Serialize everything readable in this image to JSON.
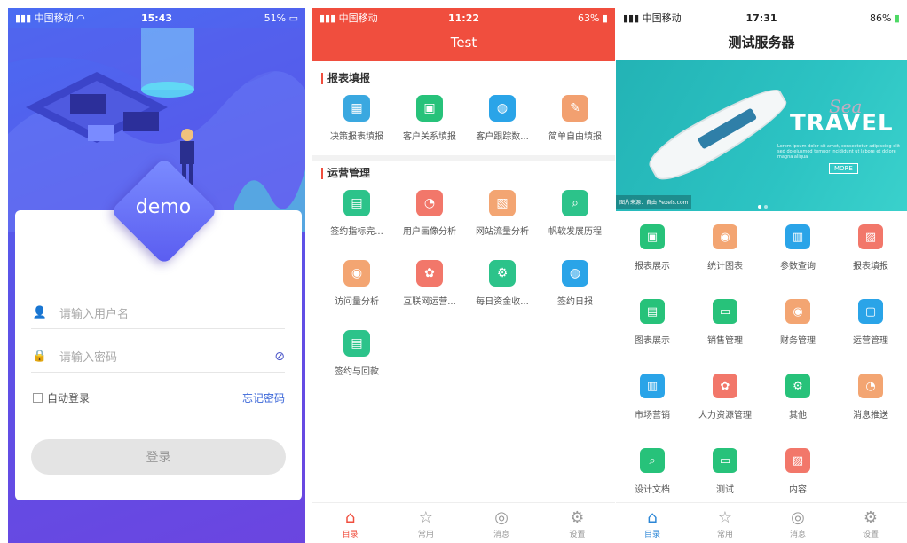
{
  "screen1": {
    "status": {
      "carrier": "中国移动",
      "time": "15:43",
      "battery": "51%"
    },
    "logo_text": "demo",
    "username_placeholder": "请输入用户名",
    "password_placeholder": "请输入密码",
    "remember_label": "自动登录",
    "forgot_label": "忘记密码",
    "login_label": "登录",
    "icons": {
      "user": "user-icon",
      "lock": "lock-icon",
      "eye": "eye-off-icon"
    }
  },
  "screen2": {
    "status": {
      "carrier": "中国移动",
      "time": "11:22",
      "battery": "63%"
    },
    "title": "Test",
    "accent": "#f04e3e",
    "section1": {
      "title": "报表填报",
      "items": [
        {
          "label": "决策报表填报",
          "color": "#3aa8e0",
          "icon": "▦"
        },
        {
          "label": "客户关系填报",
          "color": "#27c27a",
          "icon": "▣"
        },
        {
          "label": "客户跟踪数...",
          "color": "#2aa4e8",
          "icon": "◍"
        },
        {
          "label": "简单自由填报",
          "color": "#f2a070",
          "icon": "✎"
        }
      ]
    },
    "section2": {
      "title": "运营管理",
      "items": [
        {
          "label": "签约指标完...",
          "color": "#2cc38a",
          "icon": "▤"
        },
        {
          "label": "用户画像分析",
          "color": "#f2776a",
          "icon": "◔"
        },
        {
          "label": "网站流量分析",
          "color": "#f3a572",
          "icon": "▧"
        },
        {
          "label": "帆软发展历程",
          "color": "#2cc38a",
          "icon": "⌕"
        },
        {
          "label": "访问量分析",
          "color": "#f3a572",
          "icon": "◉"
        },
        {
          "label": "互联网运营...",
          "color": "#f2776a",
          "icon": "✿"
        },
        {
          "label": "每日资金收...",
          "color": "#2cc38a",
          "icon": "⚙"
        },
        {
          "label": "签约日报",
          "color": "#2aa4e8",
          "icon": "◍"
        },
        {
          "label": "签约与回款",
          "color": "#2cc38a",
          "icon": "▤"
        }
      ]
    },
    "tabs": [
      {
        "label": "目录",
        "icon": "⌂"
      },
      {
        "label": "常用",
        "icon": "☆"
      },
      {
        "label": "消息",
        "icon": "◎"
      },
      {
        "label": "设置",
        "icon": "⚙"
      }
    ]
  },
  "screen3": {
    "status": {
      "carrier": "中国移动",
      "time": "17:31",
      "battery": "86%"
    },
    "title": "测试服务器",
    "banner": {
      "sea": "Sea",
      "travel": "TRAVEL",
      "copy": "Lorem ipsum dolor sit amet, consectetur adipiscing elit sed do eiusmod tempor incididunt ut labore et dolore magna aliqua",
      "more": "MORE",
      "source": "图片来源：自由 Pexels.com"
    },
    "items": [
      {
        "label": "报表展示",
        "color": "#27c27a",
        "icon": "▣"
      },
      {
        "label": "统计图表",
        "color": "#f3a572",
        "icon": "◉"
      },
      {
        "label": "参数查询",
        "color": "#2aa4e8",
        "icon": "▥"
      },
      {
        "label": "报表填报",
        "color": "#f2776a",
        "icon": "▨"
      },
      {
        "label": "图表展示",
        "color": "#27c27a",
        "icon": "▤"
      },
      {
        "label": "销售管理",
        "color": "#27c27a",
        "icon": "▭"
      },
      {
        "label": "财务管理",
        "color": "#f3a572",
        "icon": "◉"
      },
      {
        "label": "运营管理",
        "color": "#2aa4e8",
        "icon": "▢"
      },
      {
        "label": "市场营销",
        "color": "#2aa4e8",
        "icon": "▥"
      },
      {
        "label": "人力资源管理",
        "color": "#f2776a",
        "icon": "✿"
      },
      {
        "label": "其他",
        "color": "#27c27a",
        "icon": "⚙"
      },
      {
        "label": "消息推送",
        "color": "#f3a572",
        "icon": "◔"
      },
      {
        "label": "设计文档",
        "color": "#27c27a",
        "icon": "⌕"
      },
      {
        "label": "测试",
        "color": "#27c27a",
        "icon": "▭"
      },
      {
        "label": "内容",
        "color": "#f2776a",
        "icon": "▨"
      }
    ],
    "tabs": [
      {
        "label": "目录",
        "icon": "⌂"
      },
      {
        "label": "常用",
        "icon": "☆"
      },
      {
        "label": "消息",
        "icon": "◎"
      },
      {
        "label": "设置",
        "icon": "⚙"
      }
    ]
  }
}
